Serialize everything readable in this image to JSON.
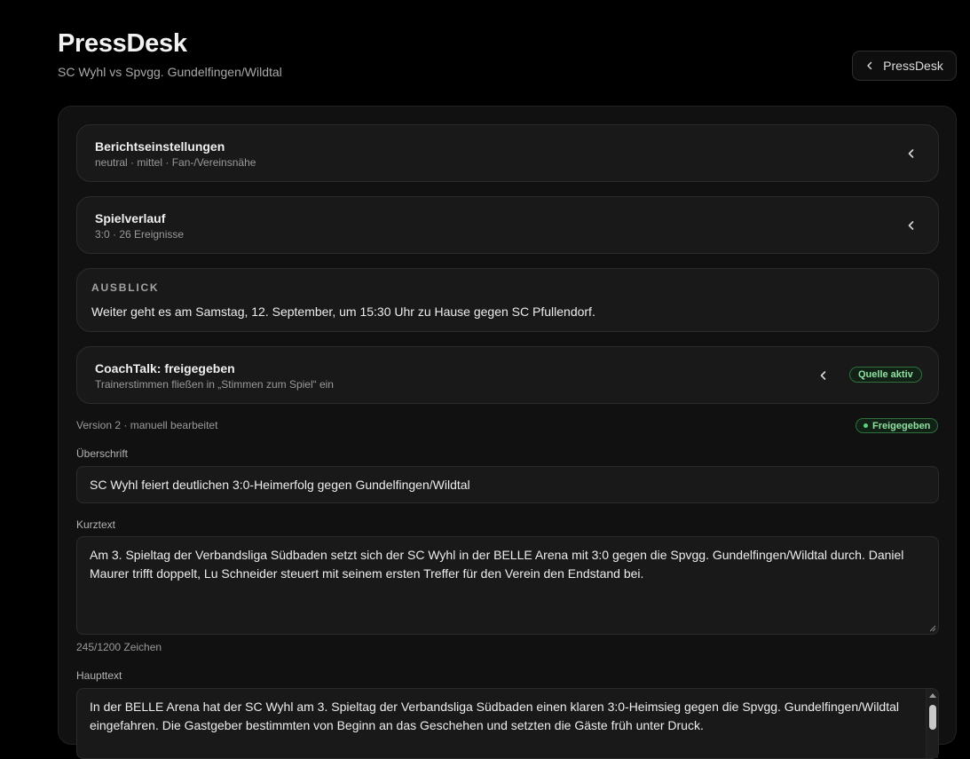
{
  "header": {
    "title": "PressDesk",
    "subtitle": "SC Wyhl vs Spvgg. Gundelfingen/Wildtal",
    "back_button_label": "PressDesk"
  },
  "report_settings": {
    "title": "Berichtseinstellungen",
    "summary": "neutral · mittel · Fan-/Vereinsnähe"
  },
  "match_flow": {
    "title": "Spielverlauf",
    "summary": "3:0 · 26 Ereignisse"
  },
  "outlook": {
    "label": "AUSBLICK",
    "text": "Weiter geht es am Samstag, 12. September, um 15:30 Uhr zu Hause gegen SC Pfullendorf."
  },
  "coachtalk": {
    "title": "CoachTalk: freigegeben",
    "summary": "Trainerstimmen fließen in „Stimmen zum Spiel“ ein",
    "badge": "Quelle aktiv"
  },
  "version": {
    "text": "Version 2 · manuell bearbeitet",
    "status_badge": "Freigegeben"
  },
  "headline": {
    "label": "Überschrift",
    "value": "SC Wyhl feiert deutlichen 3:0-Heimerfolg gegen Gundelfingen/Wildtal"
  },
  "short_text": {
    "label": "Kurztext",
    "value": "Am 3. Spieltag der Verbandsliga Südbaden setzt sich der SC Wyhl in der BELLE Arena mit 3:0 gegen die Spvgg. Gundelfingen/Wildtal durch. Daniel Maurer trifft doppelt, Lu Schneider steuert mit seinem ersten Treffer für den Verein den Endstand bei.",
    "counter": "245/1200 Zeichen"
  },
  "main_text": {
    "label": "Haupttext",
    "value": "In der BELLE Arena hat der SC Wyhl am 3. Spieltag der Verbandsliga Südbaden einen klaren 3:0-Heimsieg gegen die Spvgg. Gundelfingen/Wildtal eingefahren. Die Gastgeber bestimmten von Beginn an das Geschehen und setzten die Gäste früh unter Druck."
  },
  "colors": {
    "background": "#000000",
    "panel": "#111111",
    "card": "#191919",
    "accent_green": "#8fe1a1"
  }
}
